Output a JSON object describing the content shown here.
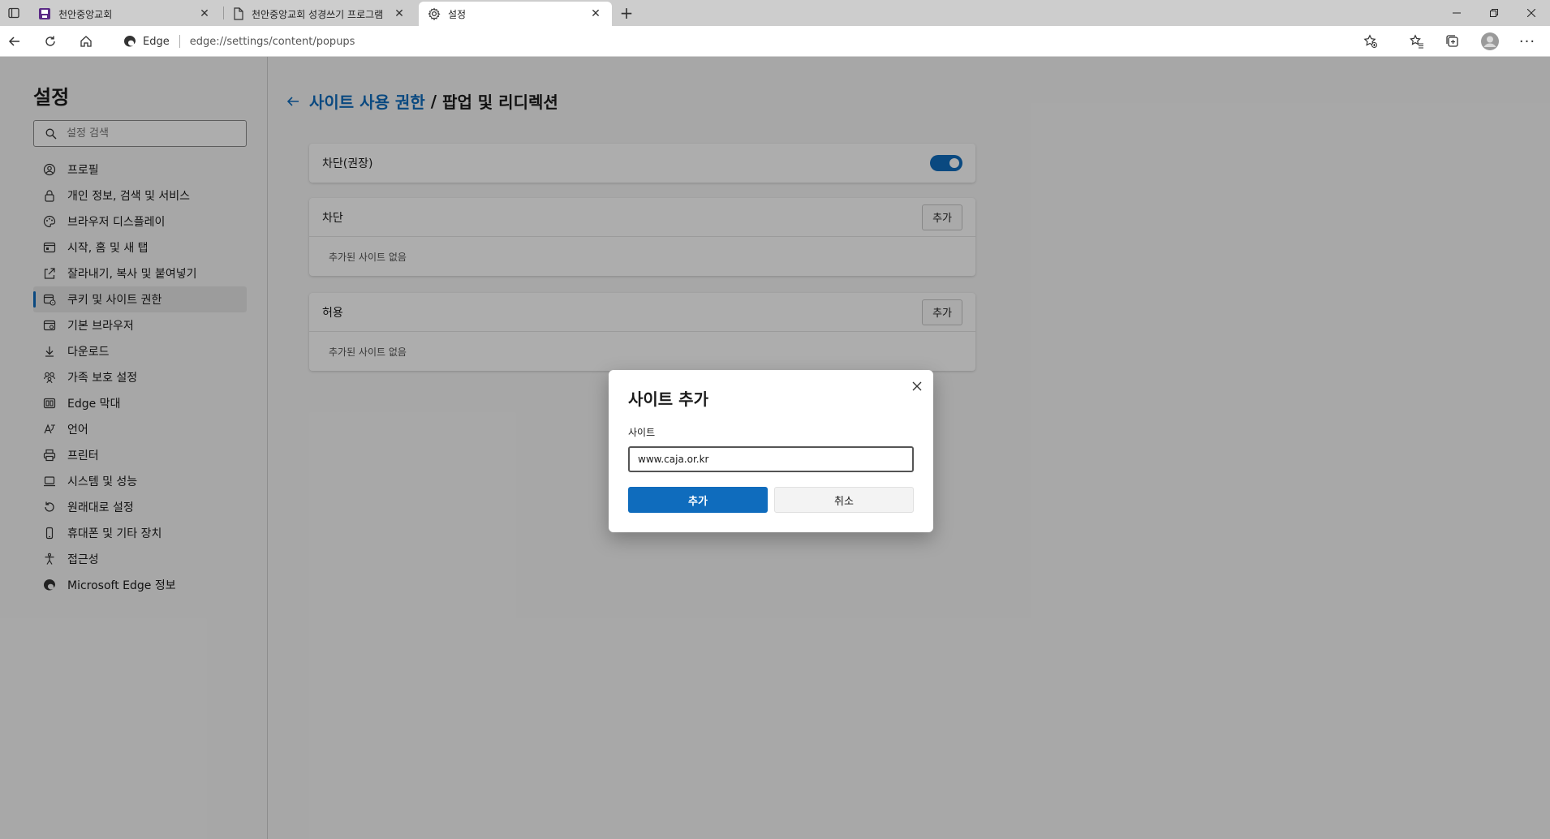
{
  "tabs": [
    {
      "title": "천안중앙교회",
      "icon": "site-favicon-icon",
      "active": false
    },
    {
      "title": "천안중앙교회 성경쓰기 프로그램",
      "icon": "page-icon",
      "active": false
    },
    {
      "title": "설정",
      "icon": "gear-icon",
      "active": true
    }
  ],
  "address": {
    "brand": "Edge",
    "url": "edge://settings/content/popups"
  },
  "sidebar": {
    "title": "설정",
    "search_placeholder": "설정 검색",
    "items": [
      {
        "label": "프로필",
        "icon": "profile-icon"
      },
      {
        "label": "개인 정보, 검색 및 서비스",
        "icon": "lock-icon"
      },
      {
        "label": "브라우저 디스플레이",
        "icon": "appearance-icon"
      },
      {
        "label": "시작, 홈 및 새 탭",
        "icon": "home-tab-icon"
      },
      {
        "label": "잘라내기, 복사 및 붙여넣기",
        "icon": "share-icon"
      },
      {
        "label": "쿠키 및 사이트 권한",
        "icon": "cookie-icon",
        "selected": true
      },
      {
        "label": "기본 브라우저",
        "icon": "browser-icon"
      },
      {
        "label": "다운로드",
        "icon": "download-icon"
      },
      {
        "label": "가족 보호 설정",
        "icon": "family-icon"
      },
      {
        "label": "Edge 막대",
        "icon": "edge-bar-icon"
      },
      {
        "label": "언어",
        "icon": "language-icon"
      },
      {
        "label": "프린터",
        "icon": "printer-icon"
      },
      {
        "label": "시스템 및 성능",
        "icon": "laptop-icon"
      },
      {
        "label": "원래대로 설정",
        "icon": "reset-icon"
      },
      {
        "label": "휴대폰 및 기타 장치",
        "icon": "phone-icon"
      },
      {
        "label": "접근성",
        "icon": "accessibility-icon"
      },
      {
        "label": "Microsoft Edge 정보",
        "icon": "edge-logo-icon"
      }
    ]
  },
  "main": {
    "breadcrumb_link": "사이트 사용 권한",
    "breadcrumb_sep": "/",
    "breadcrumb_current": "팝업 및 리디렉션",
    "block_toggle_label": "차단(권장)",
    "block_toggle_on": true,
    "blocked_section": {
      "title": "차단",
      "add_label": "추가",
      "empty_text": "추가된 사이트 없음"
    },
    "allowed_section": {
      "title": "허용",
      "add_label": "추가",
      "empty_text": "추가된 사이트 없음"
    }
  },
  "dialog": {
    "title": "사이트 추가",
    "field_label": "사이트",
    "field_value": "www.caja.or.kr",
    "ok_label": "추가",
    "cancel_label": "취소"
  },
  "colors": {
    "accent": "#0f6cbd",
    "overlay": "#000000"
  }
}
